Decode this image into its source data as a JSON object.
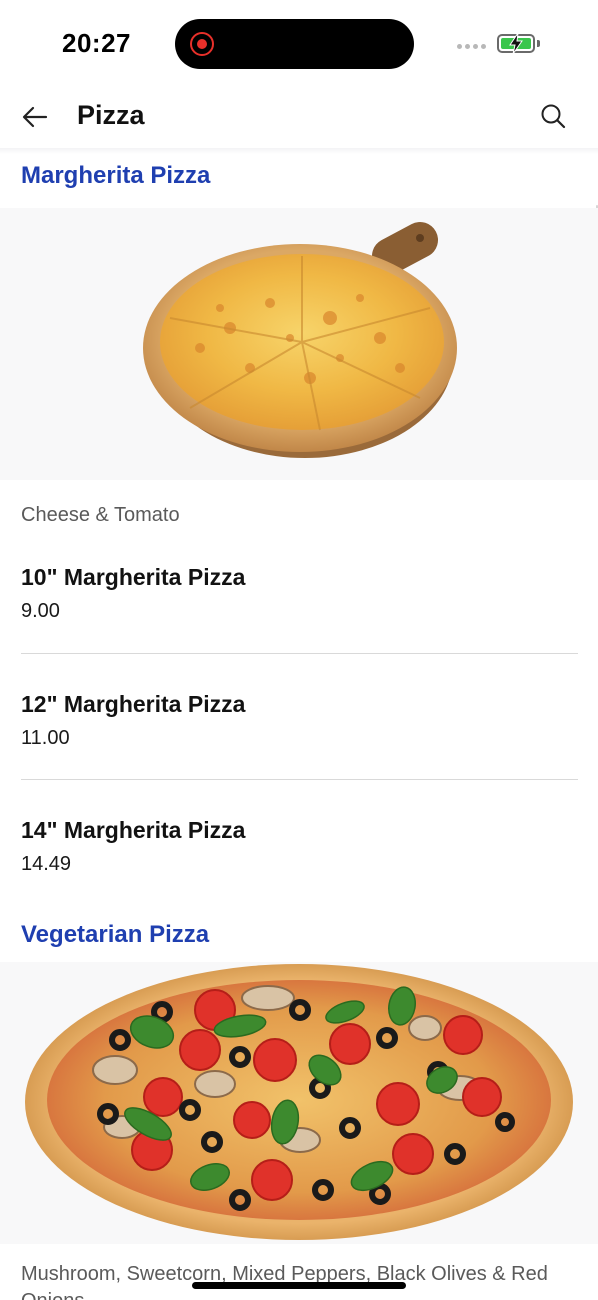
{
  "status_bar": {
    "time": "20:27",
    "recording_icon": "record-icon",
    "signal_icon": "signal-dots-icon",
    "battery_icon": "battery-charging-icon",
    "battery_color": "#3ac64c"
  },
  "header": {
    "back_icon": "arrow-left-icon",
    "title": "Pizza",
    "search_icon": "search-icon"
  },
  "colors": {
    "section_title": "#1f3fb0",
    "description": "#5a5a5a",
    "divider": "#d9d9d9"
  },
  "sections": [
    {
      "title": "Margherita Pizza",
      "image": "margherita-pizza-image",
      "description": "Cheese & Tomato",
      "items": [
        {
          "name": "10\" Margherita Pizza",
          "price": "9.00"
        },
        {
          "name": "12\" Margherita Pizza",
          "price": "11.00"
        },
        {
          "name": "14\" Margherita Pizza",
          "price": "14.49"
        }
      ]
    },
    {
      "title": "Vegetarian Pizza",
      "image": "vegetarian-pizza-image",
      "description": "Mushroom, Sweetcorn, Mixed Peppers, Black Olives & Red Onions"
    }
  ]
}
